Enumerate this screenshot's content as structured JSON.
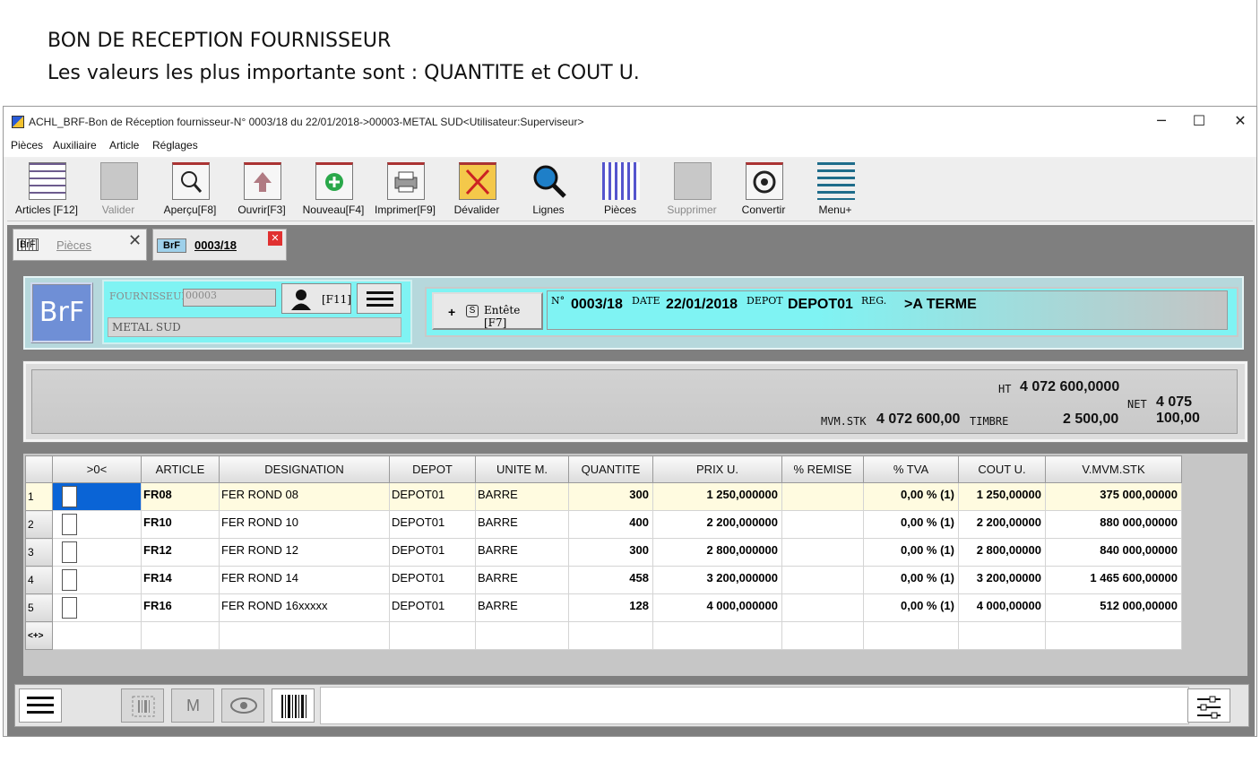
{
  "note": {
    "line1": "BON DE RECEPTION FOURNISSEUR",
    "line2": "Les valeurs les plus importante sont :  QUANTITE et COUT U."
  },
  "window": {
    "title": "ACHL_BRF-Bon de Réception fournisseur-N° 0003/18 du 22/01/2018->00003-METAL SUD<Utilisateur:Superviseur>",
    "minimize": "─",
    "maximize": "☐",
    "close": "✕"
  },
  "menu": [
    "Pièces",
    "Auxiliaire",
    "Article",
    "Réglages"
  ],
  "toolbar": [
    {
      "label": "Articles [F12]",
      "icon": "articles-grid-icon",
      "enabled": true
    },
    {
      "label": "Valider",
      "icon": "validate-icon",
      "enabled": false
    },
    {
      "label": "Aperçu[F8]",
      "icon": "preview-icon",
      "enabled": true
    },
    {
      "label": "Ouvrir[F3]",
      "icon": "open-icon",
      "enabled": true
    },
    {
      "label": "Nouveau[F4]",
      "icon": "new-icon",
      "enabled": true
    },
    {
      "label": "Imprimer[F9]",
      "icon": "printer-icon",
      "enabled": true
    },
    {
      "label": "Dévalider",
      "icon": "unvalidate-icon",
      "enabled": true
    },
    {
      "label": "Lignes",
      "icon": "magnifier-icon",
      "enabled": true
    },
    {
      "label": "Pièces",
      "icon": "pieces-grid-icon",
      "enabled": true
    },
    {
      "label": "Supprimer",
      "icon": "trash-icon",
      "enabled": false
    },
    {
      "label": "Convertir",
      "icon": "convert-icon",
      "enabled": true
    },
    {
      "label": "Menu+",
      "icon": "menu-lines-icon",
      "enabled": true
    }
  ],
  "tabs": {
    "pieces": {
      "badge": "BrF",
      "label": "Pièces",
      "close": "✕"
    },
    "doc": {
      "badge": "BrF",
      "label": "0003/18",
      "close": "✕"
    }
  },
  "supplier": {
    "logo": "BrF",
    "label": "FOURNISSEUR",
    "code": "00003",
    "name": "METAL SUD",
    "f11": "[F11]"
  },
  "header": {
    "entete_button": "Entête [F7]",
    "entete_plus": "+",
    "entete_s": "S",
    "no_label": "N°",
    "no_value": "0003/18",
    "date_label": "DATE",
    "date_value": "22/01/2018",
    "depot_label": "DEPOT",
    "depot_value": "DEPOT01",
    "reg_label": "REG.",
    "reg_value": ">A TERME"
  },
  "totals": {
    "ht_label": "HT",
    "ht_value": "4 072 600,0000",
    "net_label": "NET",
    "net_value": "4 075 100,00",
    "mvm_label": "MVM.STK",
    "mvm_value": "4 072 600,00",
    "timbre_label": "TIMBRE",
    "timbre_value": "2 500,00"
  },
  "table": {
    "columns": [
      ">0<",
      "ARTICLE",
      "DESIGNATION",
      "DEPOT",
      "UNITE M.",
      "QUANTITE",
      "PRIX U.",
      "% REMISE",
      "% TVA",
      "COUT U.",
      "V.MVM.STK"
    ],
    "rows": [
      {
        "n": "1",
        "article": "FR08",
        "designation": "FER ROND 08",
        "depot": "DEPOT01",
        "unite": "BARRE",
        "quantite": "300",
        "prix": "1 250,000000",
        "remise": "",
        "tva": "0,00 % (1)",
        "cout": "1 250,00000",
        "vmvm": "375 000,00000"
      },
      {
        "n": "2",
        "article": "FR10",
        "designation": "FER ROND 10",
        "depot": "DEPOT01",
        "unite": "BARRE",
        "quantite": "400",
        "prix": "2 200,000000",
        "remise": "",
        "tva": "0,00 % (1)",
        "cout": "2 200,00000",
        "vmvm": "880 000,00000"
      },
      {
        "n": "3",
        "article": "FR12",
        "designation": "FER ROND 12",
        "depot": "DEPOT01",
        "unite": "BARRE",
        "quantite": "300",
        "prix": "2 800,000000",
        "remise": "",
        "tva": "0,00 % (1)",
        "cout": "2 800,00000",
        "vmvm": "840 000,00000"
      },
      {
        "n": "4",
        "article": "FR14",
        "designation": "FER ROND 14",
        "depot": "DEPOT01",
        "unite": "BARRE",
        "quantite": "458",
        "prix": "3 200,000000",
        "remise": "",
        "tva": "0,00 % (1)",
        "cout": "3 200,00000",
        "vmvm": "1 465 600,00000"
      },
      {
        "n": "5",
        "article": "FR16",
        "designation": "FER ROND 16xxxxx",
        "depot": "DEPOT01",
        "unite": "BARRE",
        "quantite": "128",
        "prix": "4 000,000000",
        "remise": "",
        "tva": "0,00 % (1)",
        "cout": "4 000,00000",
        "vmvm": "512 000,00000"
      }
    ],
    "new_row_marker": "<+>"
  },
  "bottom": {
    "m_label": "M"
  },
  "colors": {
    "cyan_panel": "#7ff3f3",
    "selection": "#0a64d6",
    "logo_blue": "#6f8fd6"
  }
}
